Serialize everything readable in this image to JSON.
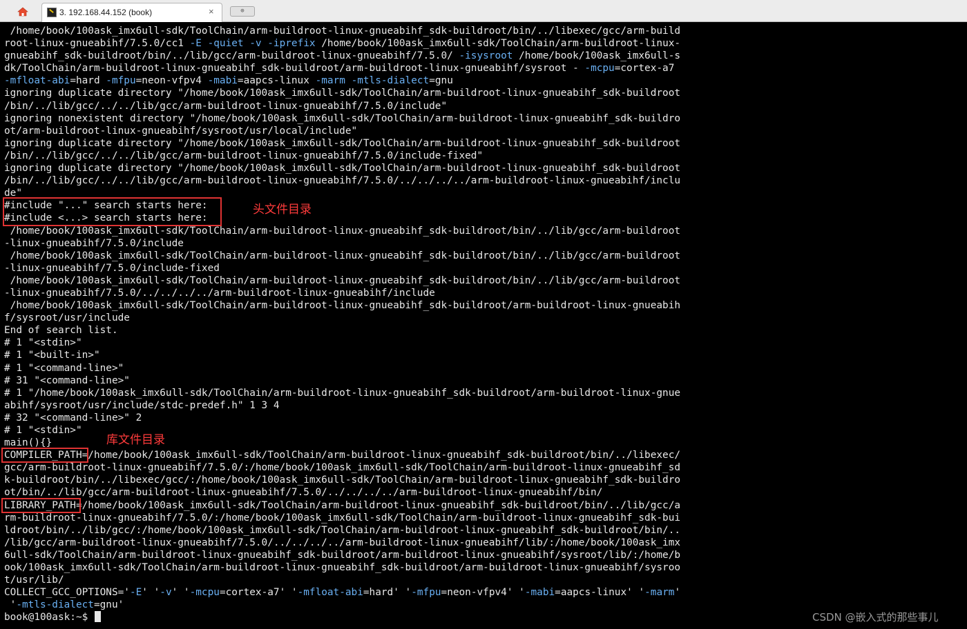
{
  "tabbar": {
    "home_icon": "home-icon",
    "tab": {
      "icon": "terminal-session-icon",
      "title": "3. 192.168.44.152  (book)",
      "close_glyph": "×"
    },
    "new_tab_glyph": "⊕"
  },
  "terminal": {
    "lines": [
      [
        {
          "t": " /home/book/100ask_imx6ull-sdk/ToolChain/arm-buildroot-linux-gnueabihf_sdk-buildroot/bin/../libexec/gcc/arm-build"
        }
      ],
      [
        {
          "t": "root-linux-gnueabihf/7.5.0/cc1 "
        },
        {
          "t": "-E",
          "c": "opt"
        },
        {
          "t": " "
        },
        {
          "t": "-quiet",
          "c": "opt"
        },
        {
          "t": " "
        },
        {
          "t": "-v",
          "c": "opt"
        },
        {
          "t": " "
        },
        {
          "t": "-iprefix",
          "c": "opt"
        },
        {
          "t": " /home/book/100ask_imx6ull-sdk/ToolChain/arm-buildroot-linux-"
        }
      ],
      [
        {
          "t": "gnueabihf_sdk-buildroot/bin/../lib/gcc/arm-buildroot-linux-gnueabihf/7.5.0/ "
        },
        {
          "t": "-isysroot",
          "c": "opt"
        },
        {
          "t": " /home/book/100ask_imx6ull-s"
        }
      ],
      [
        {
          "t": "dk/ToolChain/arm-buildroot-linux-gnueabihf_sdk-buildroot/arm-buildroot-linux-gnueabihf/sysroot - "
        },
        {
          "t": "-mcpu",
          "c": "opt"
        },
        {
          "t": "=cortex-a7"
        }
      ],
      [
        {
          "t": "-mfloat-abi",
          "c": "opt"
        },
        {
          "t": "=hard "
        },
        {
          "t": "-mfpu",
          "c": "opt"
        },
        {
          "t": "=neon-vfpv4 "
        },
        {
          "t": "-mabi",
          "c": "opt"
        },
        {
          "t": "=aapcs-linux "
        },
        {
          "t": "-marm",
          "c": "opt"
        },
        {
          "t": " "
        },
        {
          "t": "-mtls-dialect",
          "c": "opt"
        },
        {
          "t": "=gnu"
        }
      ],
      [
        {
          "t": "ignoring duplicate directory \"/home/book/100ask_imx6ull-sdk/ToolChain/arm-buildroot-linux-gnueabihf_sdk-buildroot"
        }
      ],
      [
        {
          "t": "/bin/../lib/gcc/../../lib/gcc/arm-buildroot-linux-gnueabihf/7.5.0/include\""
        }
      ],
      [
        {
          "t": "ignoring nonexistent directory \"/home/book/100ask_imx6ull-sdk/ToolChain/arm-buildroot-linux-gnueabihf_sdk-buildro"
        }
      ],
      [
        {
          "t": "ot/arm-buildroot-linux-gnueabihf/sysroot/usr/local/include\""
        }
      ],
      [
        {
          "t": "ignoring duplicate directory \"/home/book/100ask_imx6ull-sdk/ToolChain/arm-buildroot-linux-gnueabihf_sdk-buildroot"
        }
      ],
      [
        {
          "t": "/bin/../lib/gcc/../../lib/gcc/arm-buildroot-linux-gnueabihf/7.5.0/include-fixed\""
        }
      ],
      [
        {
          "t": "ignoring duplicate directory \"/home/book/100ask_imx6ull-sdk/ToolChain/arm-buildroot-linux-gnueabihf_sdk-buildroot"
        }
      ],
      [
        {
          "t": "/bin/../lib/gcc/../../lib/gcc/arm-buildroot-linux-gnueabihf/7.5.0/../../../../arm-buildroot-linux-gnueabihf/inclu"
        }
      ],
      [
        {
          "t": "de\""
        }
      ],
      [
        {
          "t": "#include \"...\" search starts here:"
        }
      ],
      [
        {
          "t": "#include <...> search starts here:"
        }
      ],
      [
        {
          "t": " /home/book/100ask_imx6ull-sdk/ToolChain/arm-buildroot-linux-gnueabihf_sdk-buildroot/bin/../lib/gcc/arm-buildroot"
        }
      ],
      [
        {
          "t": "-linux-gnueabihf/7.5.0/include"
        }
      ],
      [
        {
          "t": " /home/book/100ask_imx6ull-sdk/ToolChain/arm-buildroot-linux-gnueabihf_sdk-buildroot/bin/../lib/gcc/arm-buildroot"
        }
      ],
      [
        {
          "t": "-linux-gnueabihf/7.5.0/include-fixed"
        }
      ],
      [
        {
          "t": " /home/book/100ask_imx6ull-sdk/ToolChain/arm-buildroot-linux-gnueabihf_sdk-buildroot/bin/../lib/gcc/arm-buildroot"
        }
      ],
      [
        {
          "t": "-linux-gnueabihf/7.5.0/../../../../arm-buildroot-linux-gnueabihf/include"
        }
      ],
      [
        {
          "t": " /home/book/100ask_imx6ull-sdk/ToolChain/arm-buildroot-linux-gnueabihf_sdk-buildroot/arm-buildroot-linux-gnueabih"
        }
      ],
      [
        {
          "t": "f/sysroot/usr/include"
        }
      ],
      [
        {
          "t": "End of search list."
        }
      ],
      [
        {
          "t": "# 1 \"<stdin>\""
        }
      ],
      [
        {
          "t": "# 1 \"<built-in>\""
        }
      ],
      [
        {
          "t": "# 1 \"<command-line>\""
        }
      ],
      [
        {
          "t": "# 31 \"<command-line>\""
        }
      ],
      [
        {
          "t": "# 1 \"/home/book/100ask_imx6ull-sdk/ToolChain/arm-buildroot-linux-gnueabihf_sdk-buildroot/arm-buildroot-linux-gnue"
        }
      ],
      [
        {
          "t": "abihf/sysroot/usr/include/stdc-predef.h\" 1 3 4"
        }
      ],
      [
        {
          "t": "# 32 \"<command-line>\" 2"
        }
      ],
      [
        {
          "t": "# 1 \"<stdin>\""
        }
      ],
      [
        {
          "t": "main(){}"
        }
      ],
      [
        {
          "t": "COMPILER_PATH=/home/book/100ask_imx6ull-sdk/ToolChain/arm-buildroot-linux-gnueabihf_sdk-buildroot/bin/../libexec/"
        }
      ],
      [
        {
          "t": "gcc/arm-buildroot-linux-gnueabihf/7.5.0/:/home/book/100ask_imx6ull-sdk/ToolChain/arm-buildroot-linux-gnueabihf_sd"
        }
      ],
      [
        {
          "t": "k-buildroot/bin/../libexec/gcc/:/home/book/100ask_imx6ull-sdk/ToolChain/arm-buildroot-linux-gnueabihf_sdk-buildro"
        }
      ],
      [
        {
          "t": "ot/bin/../lib/gcc/arm-buildroot-linux-gnueabihf/7.5.0/../../../../arm-buildroot-linux-gnueabihf/bin/"
        }
      ],
      [
        {
          "t": "LIBRARY_PATH=/home/book/100ask_imx6ull-sdk/ToolChain/arm-buildroot-linux-gnueabihf_sdk-buildroot/bin/../lib/gcc/a"
        }
      ],
      [
        {
          "t": "rm-buildroot-linux-gnueabihf/7.5.0/:/home/book/100ask_imx6ull-sdk/ToolChain/arm-buildroot-linux-gnueabihf_sdk-bui"
        }
      ],
      [
        {
          "t": "ldroot/bin/../lib/gcc/:/home/book/100ask_imx6ull-sdk/ToolChain/arm-buildroot-linux-gnueabihf_sdk-buildroot/bin/.."
        }
      ],
      [
        {
          "t": "/lib/gcc/arm-buildroot-linux-gnueabihf/7.5.0/../../../../arm-buildroot-linux-gnueabihf/lib/:/home/book/100ask_imx"
        }
      ],
      [
        {
          "t": "6ull-sdk/ToolChain/arm-buildroot-linux-gnueabihf_sdk-buildroot/arm-buildroot-linux-gnueabihf/sysroot/lib/:/home/b"
        }
      ],
      [
        {
          "t": "ook/100ask_imx6ull-sdk/ToolChain/arm-buildroot-linux-gnueabihf_sdk-buildroot/arm-buildroot-linux-gnueabihf/sysroo"
        }
      ],
      [
        {
          "t": "t/usr/lib/"
        }
      ],
      [
        {
          "t": "COLLECT_GCC_OPTIONS='"
        },
        {
          "t": "-E",
          "c": "opt"
        },
        {
          "t": "' '"
        },
        {
          "t": "-v",
          "c": "opt"
        },
        {
          "t": "' '"
        },
        {
          "t": "-mcpu",
          "c": "opt"
        },
        {
          "t": "=cortex-a7' '"
        },
        {
          "t": "-mfloat-abi",
          "c": "opt"
        },
        {
          "t": "=hard' '"
        },
        {
          "t": "-mfpu",
          "c": "opt"
        },
        {
          "t": "=neon-vfpv4' '"
        },
        {
          "t": "-mabi",
          "c": "opt"
        },
        {
          "t": "=aapcs-linux' '"
        },
        {
          "t": "-marm",
          "c": "opt"
        },
        {
          "t": "'"
        }
      ],
      [
        {
          "t": " '"
        },
        {
          "t": "-mtls-dialect",
          "c": "opt"
        },
        {
          "t": "=gnu'"
        }
      ],
      [
        {
          "t": "book@100ask:~$ "
        }
      ]
    ],
    "prompt_line_index": 47
  },
  "annotations": {
    "header_dir_label": "头文件目录",
    "lib_dir_label": "库文件目录",
    "color": "#e03333"
  },
  "watermark": "CSDN @嵌入式的那些事儿",
  "colors": {
    "terminal_bg": "#000000",
    "terminal_fg": "#e8e8e8",
    "option_fg": "#6ab0f3",
    "annotation": "#e03333"
  }
}
